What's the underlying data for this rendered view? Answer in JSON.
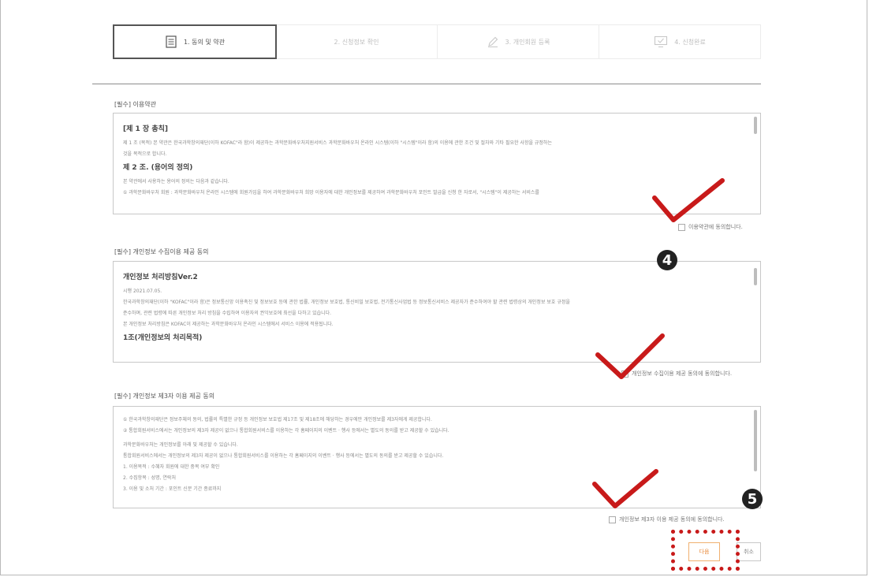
{
  "steps": [
    {
      "label": "1. 동의 및 약관",
      "icon": "document-icon"
    },
    {
      "label": "2. 신청정보 확인",
      "icon": ""
    },
    {
      "label": "3. 개인회원 등록",
      "icon": "pencil-icon"
    },
    {
      "label": "4. 신청완료",
      "icon": "monitor-check-icon"
    }
  ],
  "terms": {
    "title": "[필수] 이용약관",
    "h1": "[제 1 장 총칙]",
    "p1a": "제 1 조 (목적) 본 약관은 한국과학창의재단(이하 KOFAC\"라 함)이 제공하는 과학문화바우처지원서비스 과학문화바우처 온라인 시스템(이하 \"시스템\"이라 함)의 이용에 관한 조건 및 절차와 기타 필요한 사항을 규정하는",
    "p1b": "것을 목적으로 합니다.",
    "h2": "제 2 조. (용어의 정의)",
    "p2": "본 약관에서 사용하는 용어의 정의는 다음과 같습니다.",
    "p3": "① 과학문화바우처 회원 : 과학문화바우처 온라인 시스템에 회원가입을 하여 과학문화바우처 희망 이용자에 대한 개인정보를 제공하여 과학문화바우처 포인트 발급을 신청 한 자로서, \"시스템\"이 제공하는 서비스를",
    "agree": "이용약관에 동의합니다."
  },
  "privacy": {
    "title": "[필수] 개인정보 수집이용 제공 동의",
    "h1": "개인정보 처리방침Ver.2",
    "p1": "시행 2021.07.05.",
    "p2a": "한국과학창의재단(이하 \"KOFAC\"이라 함)은 정보통신망 이용촉진 및 정보보호 등에 관한 법률, 개인정보 보호법, 통신비밀 보호법, 전기통신사업법 등 정보통신서비스 제공자가 준수하여야 할 관련 법령상의 개인정보 보호 규정을",
    "p2b": "준수하며, 관련 법령에 따른 개인정보 처리 방침을 수립하여 이용자의 권익보호에 최선을 다하고 있습니다.",
    "p3": "본 개인정보 처리방침은 KOFAC이 제공하는 과학문화바우처 온라인 시스템에서 서비스 이용에 적용됩니다.",
    "h2": "1조(개인정보의 처리목적)",
    "agree": "개인정보 수집이용 제공 동의에 동의합니다."
  },
  "third": {
    "title": "[필수] 개인정보 제3자 이용 제공 동의",
    "p1": "① 한국과학창의재단은 정보주체의 동의, 법률의 특별한 규정 등 개인정보 보호법 제17조 및 제18조에 해당하는 경우에만 개인정보를 제3자에게 제공합니다.",
    "p2": "② 통합회원서비스에서는 개인정보의 제3자 제공이 없으나 통합회원서비스를 이용하는 각 홈페이지의 이벤트 · 행사 등에서는 별도의 동의를 받고 제공할 수 있습니다.",
    "p3": "과학문화바우처는 개인정보를 아래 및 제공할 수 있습니다.",
    "p4": "통합회원서비스에서는 개인정보의 제3자 제공이 없으나 통합회원서비스를 이용하는 각 홈페이지의 이벤트 · 행사 등에서는 별도의 동의를 받고 제공할 수 있습니다.",
    "p5": "1. 이용목적 : 수혜자 회원에 대한 중복 여부 확인",
    "p6": "2. 수집항목 : 성명, 연락처",
    "p7": "3. 이용 및 소처 기간 : 포인트 신분 기간 종료까지",
    "agree": "개인정보 제3자 이용 제공 동의에 동의합니다."
  },
  "badges": {
    "four": "4",
    "five": "5"
  },
  "buttons": {
    "next": "다음",
    "cancel": "취소"
  },
  "colors": {
    "accent_check": "#c81a1a",
    "badge": "#222222",
    "next_btn": "#e8893a"
  }
}
